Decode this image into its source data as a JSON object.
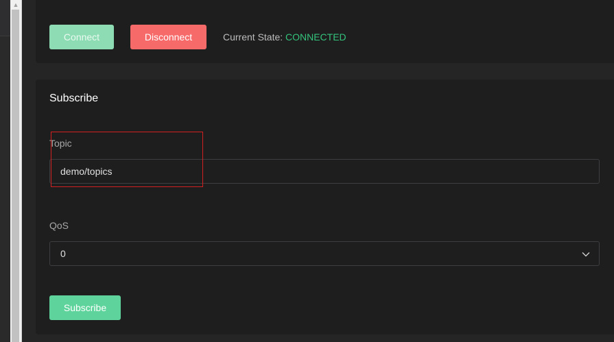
{
  "connection": {
    "connect_label": "Connect",
    "disconnect_label": "Disconnect",
    "state_label": "Current State:",
    "state_value": "CONNECTED"
  },
  "subscribe": {
    "title": "Subscribe",
    "topic_label": "Topic",
    "topic_value": "demo/topics",
    "qos_label": "QoS",
    "qos_value": "0",
    "subscribe_label": "Subscribe"
  },
  "colors": {
    "connect": "#8ddcb4",
    "disconnect": "#f76a6a",
    "connected_state": "#34c47c",
    "subscribe_button": "#5ed49c",
    "highlight": "#d42020"
  },
  "icons": {
    "select_chevron": "chevron-down-icon",
    "scroll_up": "scroll-up-arrow-icon"
  }
}
